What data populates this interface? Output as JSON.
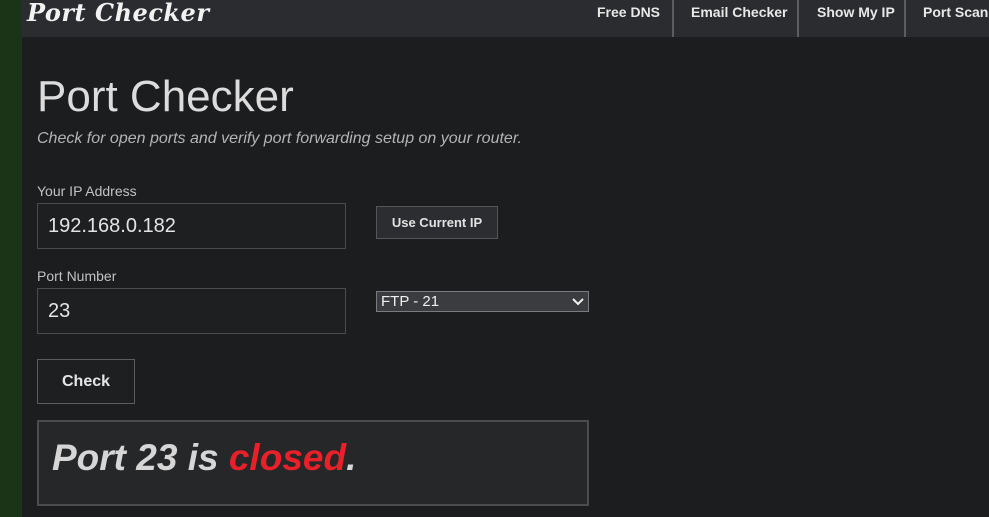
{
  "nav": {
    "logo": "Port Checker",
    "items": [
      {
        "label": "Free DNS"
      },
      {
        "label": "Email Checker"
      },
      {
        "label": "Show My IP"
      },
      {
        "label": "Port Scann"
      }
    ]
  },
  "main": {
    "title": "Port Checker",
    "subtitle": "Check for open ports and verify port forwarding setup on your router.",
    "ip_field": {
      "label": "Your IP Address",
      "value": "192.168.0.182"
    },
    "use_current_ip_label": "Use Current IP",
    "port_field": {
      "label": "Port Number",
      "value": "23"
    },
    "port_select": {
      "selected": "FTP - 21"
    },
    "check_label": "Check",
    "result": {
      "prefix": "Port 23 is ",
      "status": "closed",
      "suffix": "."
    }
  },
  "colors": {
    "background": "#1c1d1f",
    "navbar": "#2b2c2f",
    "closed_status": "#e8202a"
  }
}
